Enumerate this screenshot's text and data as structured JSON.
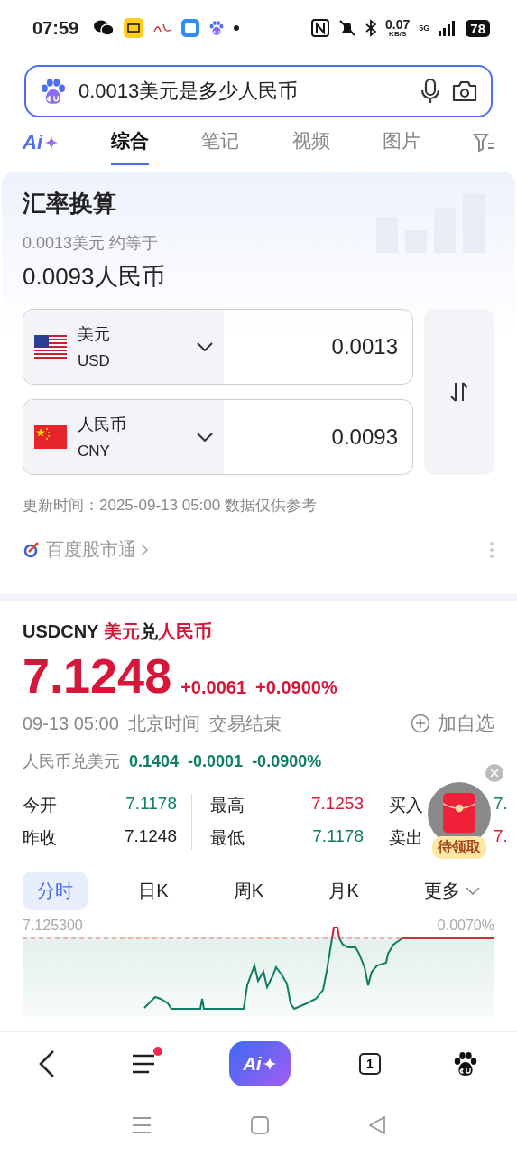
{
  "status_bar": {
    "time": "07:59",
    "net_speed": "0.07",
    "net_unit": "KB/S",
    "network": "5G",
    "battery": "78"
  },
  "search": {
    "value": "0.0013美元是多少人民币"
  },
  "tabs": [
    {
      "label": "Ai",
      "kind": "ai",
      "selected": false
    },
    {
      "label": "综合",
      "kind": "text",
      "selected": true
    },
    {
      "label": "笔记",
      "kind": "text",
      "selected": false
    },
    {
      "label": "视频",
      "kind": "text",
      "selected": false
    },
    {
      "label": "图片",
      "kind": "text",
      "selected": false
    },
    {
      "kind": "filter",
      "selected": false
    }
  ],
  "converter": {
    "title": "汇率换算",
    "subtitle": "0.0013美元 约等于",
    "result": "0.0093人民币",
    "rows": [
      {
        "kind": "us",
        "name": "美元",
        "code": "USD",
        "value": "0.0013"
      },
      {
        "kind": "cn",
        "name": "人民币",
        "code": "CNY",
        "value": "0.0093"
      }
    ],
    "updated": "更新时间：2025-09-13 05:00 数据仅供参考",
    "source": "百度股市通"
  },
  "quote": {
    "symbol": "USDCNY",
    "title_parts": [
      {
        "text": "美元",
        "color": "#d7173a"
      },
      {
        "text": "兑",
        "color": "#222222"
      },
      {
        "text": "人民币",
        "color": "#d7173a"
      }
    ],
    "price": "7.1248",
    "change": "+0.0061",
    "change_pct": "+0.0900%",
    "color": "#d7173a",
    "time": "09-13 05:00",
    "timezone": "北京时间",
    "market_status": "交易结束",
    "watch": "加自选",
    "inverse": {
      "label": "人民币兑美元",
      "price": "0.1404",
      "change": "-0.0001",
      "change_pct": "-0.0900%",
      "color": "#0d7e62"
    },
    "stats": [
      [
        {
          "label": "今开",
          "value": "7.1178",
          "color": "#0d7e62"
        },
        {
          "label": "昨收",
          "value": "7.1248",
          "color": "#222222"
        }
      ],
      [
        {
          "label": "最高",
          "value": "7.1253",
          "color": "#d7173a"
        },
        {
          "label": "最低",
          "value": "7.1178",
          "color": "#0d7e62"
        }
      ],
      [
        {
          "label": "买入",
          "value": "7.",
          "color": "#0d7e62"
        },
        {
          "label": "卖出",
          "value": "7.",
          "color": "#d7173a"
        }
      ]
    ],
    "promo": {
      "label": "待领取"
    },
    "periods": [
      {
        "label": "分时",
        "selected": true
      },
      {
        "label": "日K",
        "selected": false
      },
      {
        "label": "周K",
        "selected": false
      },
      {
        "label": "月K",
        "selected": false
      },
      {
        "label": "更多",
        "selected": false
      }
    ],
    "chart": {
      "high_label": "7.125300",
      "high_pct": "0.0070%"
    }
  },
  "bottom_nav": {
    "ai_label": "Ai",
    "tab_count": "1",
    "menu_badge": true
  }
}
